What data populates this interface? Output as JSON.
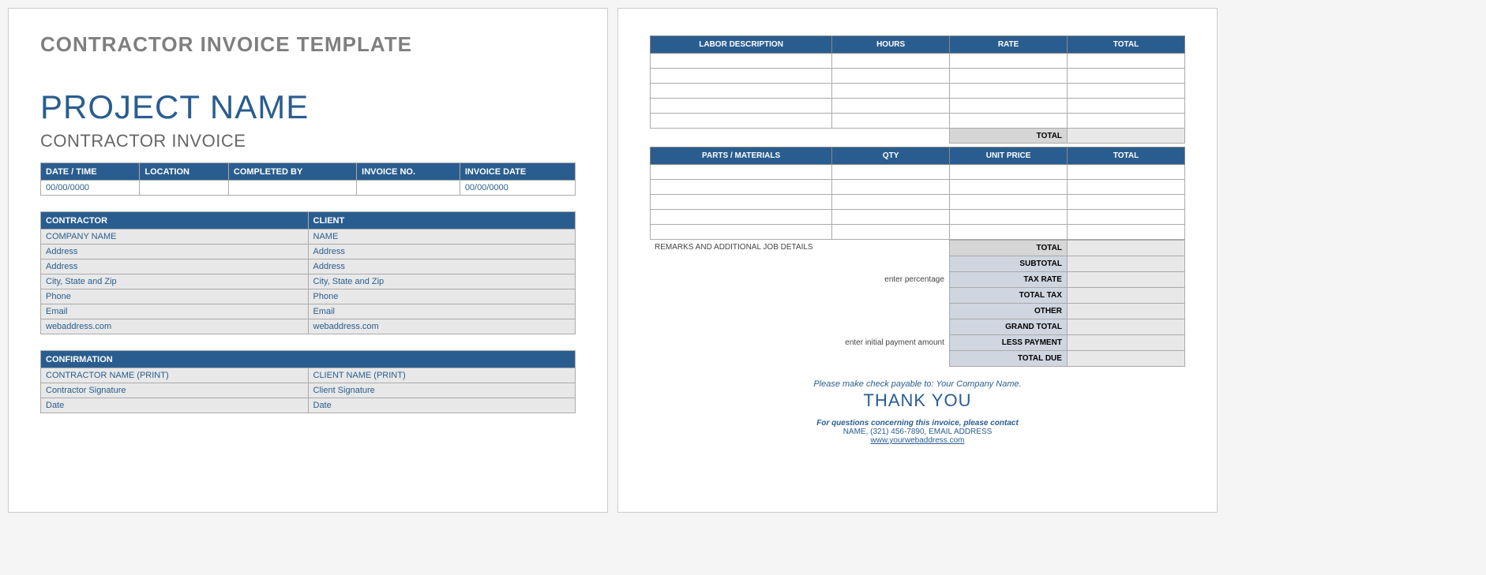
{
  "page1": {
    "template_title": "CONTRACTOR INVOICE TEMPLATE",
    "project_title": "PROJECT NAME",
    "subtitle": "CONTRACTOR INVOICE",
    "meta": {
      "headers": [
        "DATE / TIME",
        "LOCATION",
        "COMPLETED BY",
        "INVOICE NO.",
        "INVOICE DATE"
      ],
      "values": [
        "00/00/0000",
        "",
        "",
        "",
        "00/00/0000"
      ]
    },
    "info": {
      "contractor_header": "CONTRACTOR",
      "client_header": "CLIENT",
      "contractor": [
        "COMPANY NAME",
        "Address",
        "Address",
        "City, State and Zip",
        "Phone",
        "Email",
        "webaddress.com"
      ],
      "client": [
        "NAME",
        "Address",
        "Address",
        "City, State and Zip",
        "Phone",
        "Email",
        "webaddress.com"
      ]
    },
    "confirmation": {
      "header": "CONFIRMATION",
      "contractor": [
        "CONTRACTOR NAME (PRINT)",
        "Contractor Signature",
        "Date"
      ],
      "client": [
        "CLIENT NAME (PRINT)",
        "Client Signature",
        "Date"
      ]
    }
  },
  "page2": {
    "labor_headers": [
      "LABOR DESCRIPTION",
      "HOURS",
      "RATE",
      "TOTAL"
    ],
    "labor_total_label": "TOTAL",
    "parts_headers": [
      "PARTS / MATERIALS",
      "QTY",
      "UNIT PRICE",
      "TOTAL"
    ],
    "remarks_label": "REMARKS AND ADDITIONAL JOB DETAILS",
    "hints": {
      "percentage": "enter percentage",
      "initial_payment": "enter initial payment amount"
    },
    "summary": {
      "total": "TOTAL",
      "subtotal": "SUBTOTAL",
      "tax_rate": "TAX RATE",
      "total_tax": "TOTAL TAX",
      "other": "OTHER",
      "grand_total": "GRAND TOTAL",
      "less_payment": "LESS PAYMENT",
      "total_due": "TOTAL DUE"
    },
    "footer": {
      "payable": "Please make check payable to: Your Company Name.",
      "thankyou": "THANK YOU",
      "contact1": "For questions concerning this invoice, please contact",
      "contact2": "NAME, (321) 456-7890, EMAIL ADDRESS",
      "web": "www.yourwebaddress.com"
    }
  }
}
